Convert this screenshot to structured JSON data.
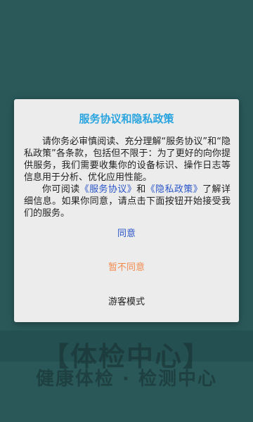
{
  "background": {
    "text_line1": "【体检中心】",
    "text_line2": "健康体检 · 检测中心"
  },
  "dialog": {
    "title": "服务协议和隐私政策",
    "paragraph1": "请你务必审慎阅读、充分理解“服务协议”和“隐私政策”各条款，包括但不限于：为了更好的向你提供服务，我们需要收集你的设备标识、操作日志等信息用于分析、优化应用性能。",
    "paragraph2_prefix": "你可阅读",
    "service_link": "《服务协议》",
    "paragraph2_and": "和",
    "privacy_link": "《隐私政策》",
    "paragraph2_suffix": "了解详细信息。如果你同意，请点击下面按钮开始接受我们的服务。",
    "agree_label": "同意",
    "disagree_label": "暂不同意",
    "guest_label": "游客模式"
  },
  "colors": {
    "title": "#2aa4df",
    "link": "#2a55c9",
    "disagree": "#f28a4e",
    "background": "#356b6d"
  }
}
